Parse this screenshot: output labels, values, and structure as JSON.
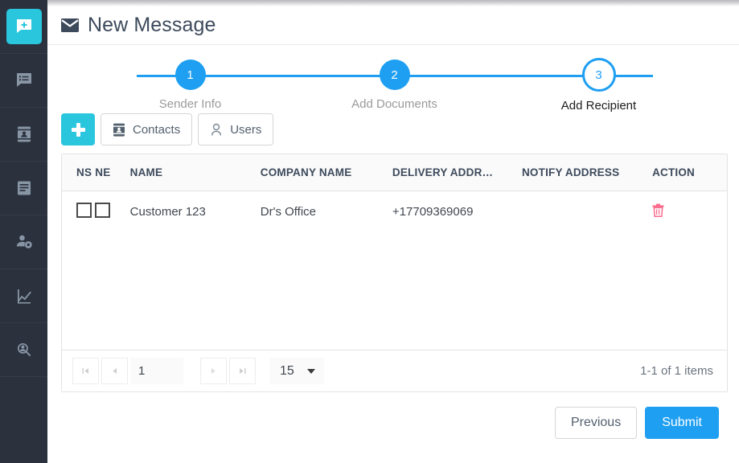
{
  "theme": {
    "sidebar_bg": "#2b313d",
    "accent_teal": "#29c6dd",
    "accent_blue": "#1e9ff2",
    "danger_pink": "#fb6a8a",
    "header_text": "#3d4a5c"
  },
  "sidebar": {
    "items": [
      {
        "icon": "new-message-icon",
        "active": true
      },
      {
        "icon": "message-list-icon",
        "active": false
      },
      {
        "icon": "contacts-book-icon",
        "active": false
      },
      {
        "icon": "documents-icon",
        "active": false
      },
      {
        "icon": "user-settings-icon",
        "active": false
      },
      {
        "icon": "analytics-chart-icon",
        "active": false
      },
      {
        "icon": "user-search-icon",
        "active": false
      }
    ]
  },
  "header": {
    "icon": "envelope-icon",
    "title": "New Message"
  },
  "stepper": {
    "steps": [
      {
        "number": "1",
        "label": "Sender Info",
        "state": "done"
      },
      {
        "number": "2",
        "label": "Add Documents",
        "state": "done"
      },
      {
        "number": "3",
        "label": "Add Recipient",
        "state": "current"
      }
    ]
  },
  "toolbar": {
    "add_label": "+",
    "contacts_label": "Contacts",
    "users_label": "Users"
  },
  "table": {
    "columns": [
      "NS",
      "NE",
      "NAME",
      "COMPANY NAME",
      "DELIVERY ADDR…",
      "NOTIFY ADDRESS",
      "ACTION"
    ],
    "rows": [
      {
        "ns_checked": false,
        "ne_checked": false,
        "name": "Customer 123",
        "company_name": "Dr's Office",
        "delivery_address": "+17709369069",
        "notify_address": "",
        "action_icon": "trash-icon"
      }
    ]
  },
  "pager": {
    "first_label": "⏮",
    "prev_label": "◀",
    "next_label": "▶",
    "last_label": "⏭",
    "page_value": "1",
    "page_size": "15",
    "info": "1-1 of 1 items"
  },
  "actions": {
    "previous_label": "Previous",
    "submit_label": "Submit"
  }
}
